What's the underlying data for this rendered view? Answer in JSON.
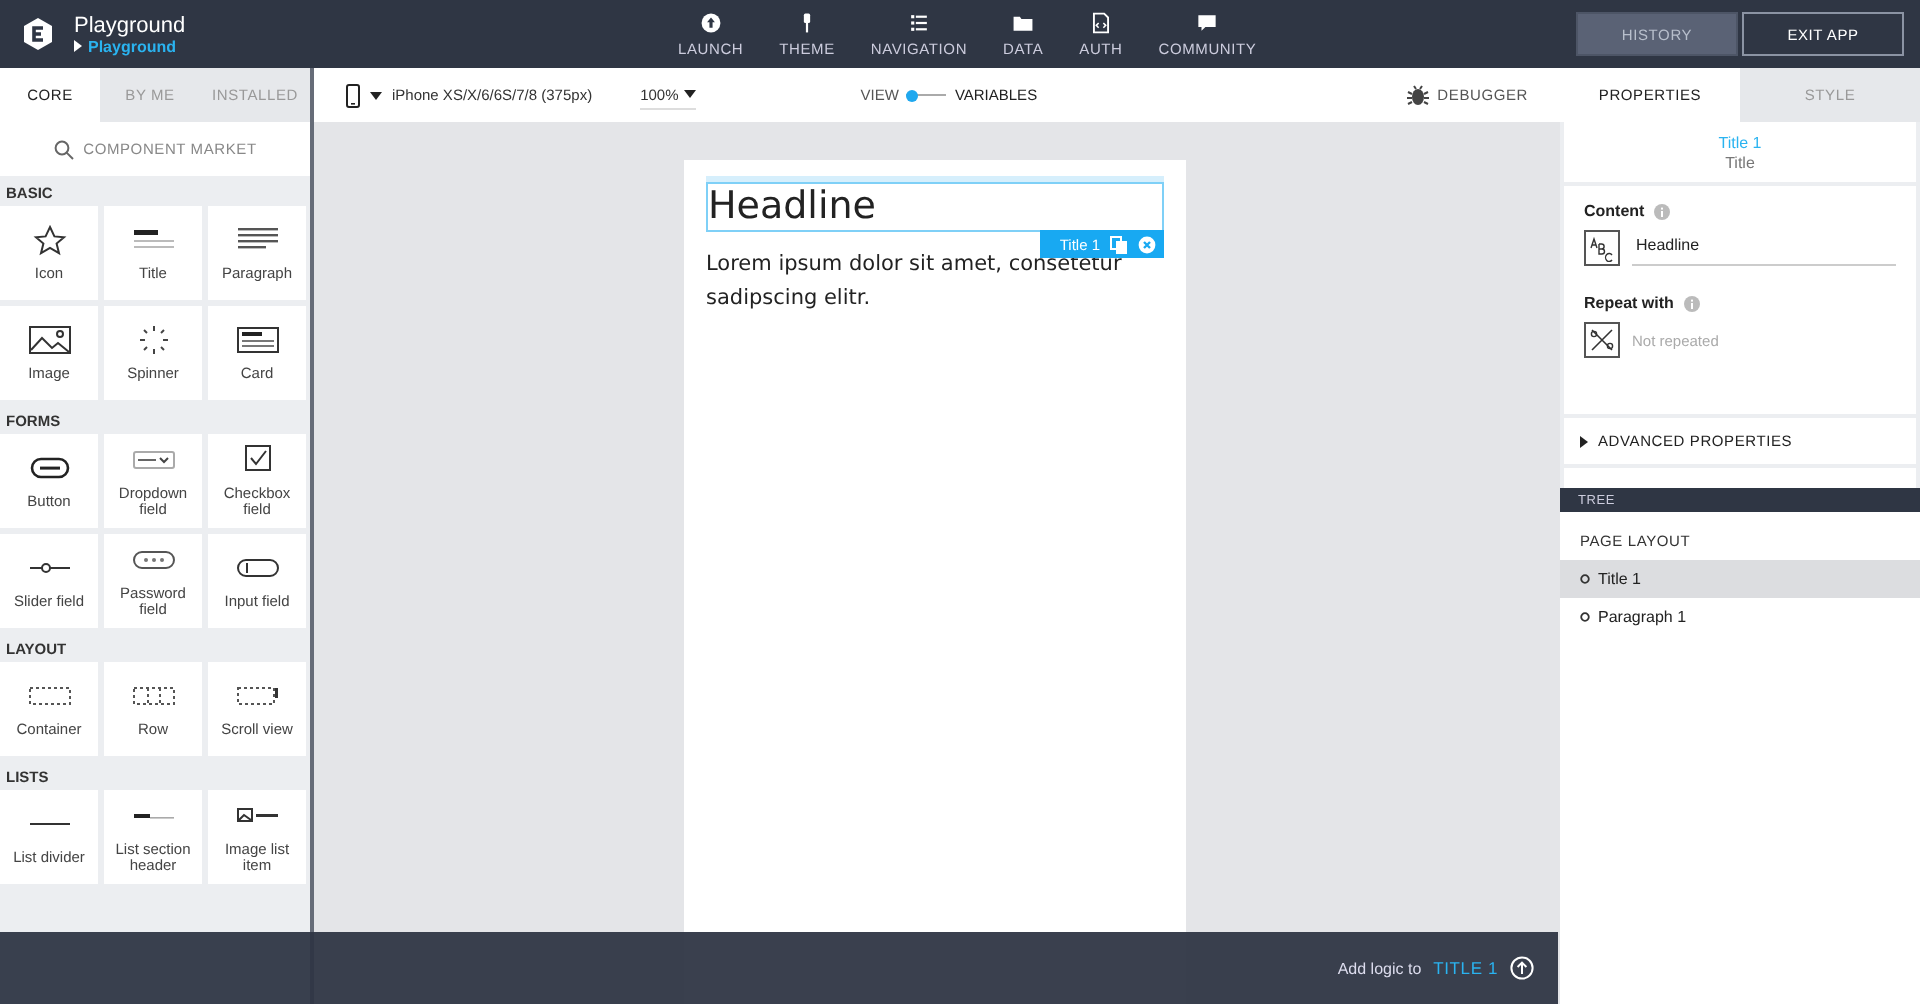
{
  "app": {
    "title": "Playground",
    "breadcrumb": "Playground"
  },
  "nav": [
    {
      "label": "LAUNCH",
      "kind": "launch"
    },
    {
      "label": "THEME",
      "kind": "theme"
    },
    {
      "label": "NAVIGATION",
      "kind": "navigation"
    },
    {
      "label": "DATA",
      "kind": "data"
    },
    {
      "label": "AUTH",
      "kind": "auth"
    },
    {
      "label": "COMMUNITY",
      "kind": "community"
    }
  ],
  "header_buttons": [
    {
      "label": "HISTORY",
      "kind": "history"
    },
    {
      "label": "EXIT APP",
      "kind": "exit"
    }
  ],
  "left_tabs": [
    {
      "label": "CORE",
      "selected": true
    },
    {
      "label": "BY ME",
      "selected": false
    },
    {
      "label": "INSTALLED",
      "selected": false
    }
  ],
  "component_market": "COMPONENT MARKET",
  "sections": [
    {
      "title": "BASIC",
      "items": [
        {
          "label": "Icon",
          "kind": "star"
        },
        {
          "label": "Title",
          "kind": "title"
        },
        {
          "label": "Paragraph",
          "kind": "paragraph"
        },
        {
          "label": "Image",
          "kind": "image"
        },
        {
          "label": "Spinner",
          "kind": "spinner"
        },
        {
          "label": "Card",
          "kind": "card"
        }
      ]
    },
    {
      "title": "FORMS",
      "items": [
        {
          "label": "Button",
          "kind": "button"
        },
        {
          "label": "Dropdown field",
          "kind": "dropdown"
        },
        {
          "label": "Checkbox field",
          "kind": "checkbox"
        },
        {
          "label": "Slider field",
          "kind": "slider"
        },
        {
          "label": "Password field",
          "kind": "password"
        },
        {
          "label": "Input field",
          "kind": "input"
        }
      ]
    },
    {
      "title": "LAYOUT",
      "items": [
        {
          "label": "Container",
          "kind": "container"
        },
        {
          "label": "Row",
          "kind": "row"
        },
        {
          "label": "Scroll view",
          "kind": "scroll"
        }
      ]
    },
    {
      "title": "LISTS",
      "items": [
        {
          "label": "List divider",
          "kind": "divider"
        },
        {
          "label": "List section header",
          "kind": "section"
        },
        {
          "label": "Image list item",
          "kind": "imagelist"
        }
      ]
    }
  ],
  "toolbar": {
    "device": "iPhone XS/X/6/6S/7/8 (375px)",
    "zoom": "100%",
    "toggle": {
      "left_label": "VIEW",
      "right_label": "VARIABLES",
      "on": false
    },
    "debugger": "DEBUGGER"
  },
  "canvas": {
    "headline": "Headline",
    "selection_badge": "Title 1",
    "paragraph": "Lorem ipsum dolor sit amet, consetetur sadipscing elitr."
  },
  "right_tabs": [
    {
      "label": "PROPERTIES",
      "selected": true
    },
    {
      "label": "STYLE",
      "selected": false
    }
  ],
  "component": {
    "name": "Title 1",
    "type": "Title"
  },
  "properties": {
    "content_label": "Content",
    "content_value": "Headline",
    "repeat_label": "Repeat with",
    "repeat_value": "Not repeated",
    "advanced": "ADVANCED PROPERTIES"
  },
  "tree": {
    "header": "TREE",
    "root": "PAGE LAYOUT",
    "children": [
      {
        "label": "Title 1",
        "selected": true
      },
      {
        "label": "Paragraph 1",
        "selected": false
      }
    ]
  },
  "bottom_bar": {
    "text": "Add logic to",
    "target": "TITLE 1"
  }
}
